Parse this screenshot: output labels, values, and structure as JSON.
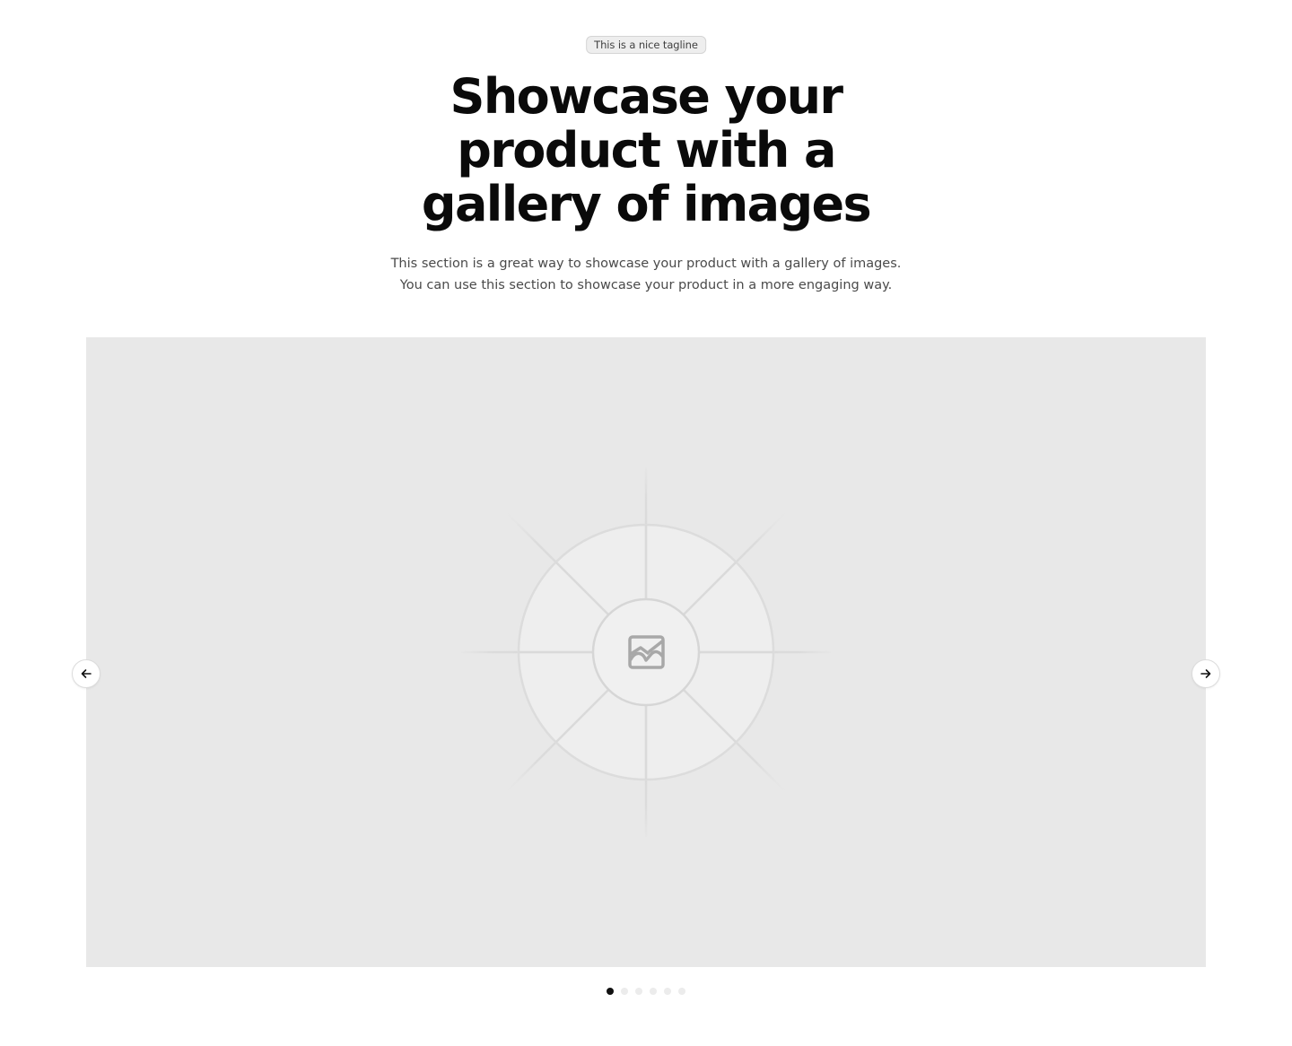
{
  "hero": {
    "tagline": "This is a nice tagline",
    "headline_lines": [
      "Showcase your",
      "product with a",
      "gallery of images"
    ],
    "description_lines": [
      "This section is a great way to showcase your product with a gallery of images.",
      "You can use this section to showcase your product in a more engaging way."
    ]
  },
  "gallery": {
    "image_icon": "image-icon",
    "background_color": "#e8e8e8",
    "prev_icon": "arrow-left-icon",
    "next_icon": "arrow-right-icon",
    "slide_count": 6,
    "active_slide": 1
  }
}
